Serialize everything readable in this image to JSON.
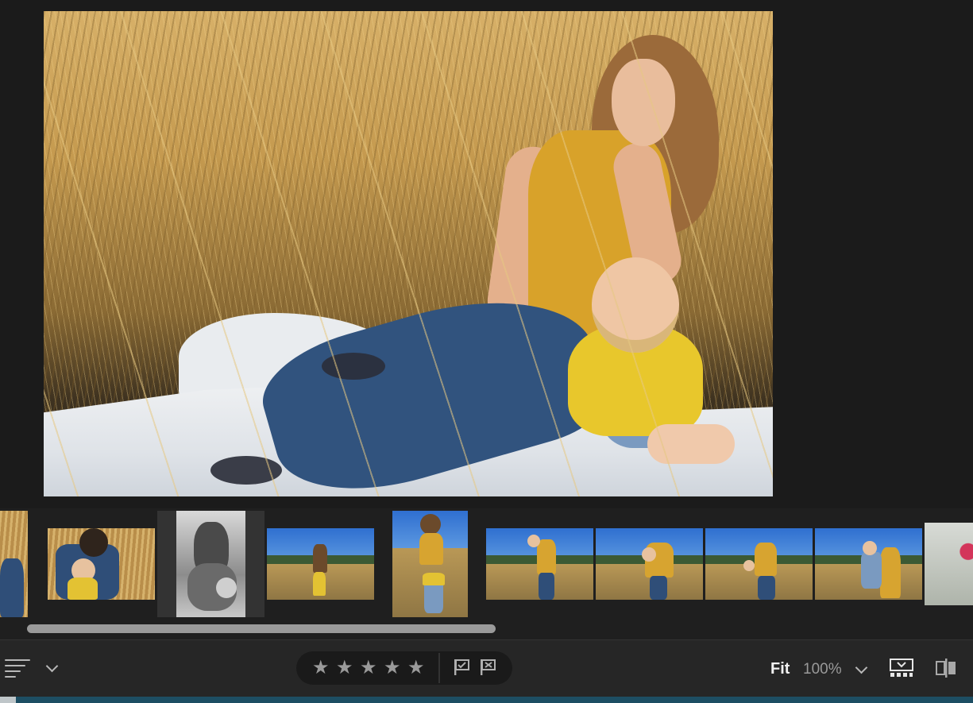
{
  "toolbar": {
    "fit_label": "Fit",
    "zoom_label": "100%",
    "rating_stars": [
      "★",
      "★",
      "★",
      "★",
      "★"
    ]
  },
  "icons": {
    "sort": "sort-lines-icon",
    "sort_menu": "chevron-down-icon",
    "pick_flag": "flag-pick-icon",
    "reject_flag": "flag-reject-icon",
    "zoom_menu": "chevron-down-icon",
    "filmstrip": "filmstrip-toggle-icon",
    "compare": "compare-view-icon"
  },
  "colors": {
    "background": "#1b1b1b",
    "toolbar": "#262626",
    "pill": "#1a1a1a",
    "selected_outline": "#f0f0f0",
    "accent_strip": "#1d4e63"
  },
  "filmstrip": {
    "thumbnail_count": 11,
    "selected_index": 2
  }
}
